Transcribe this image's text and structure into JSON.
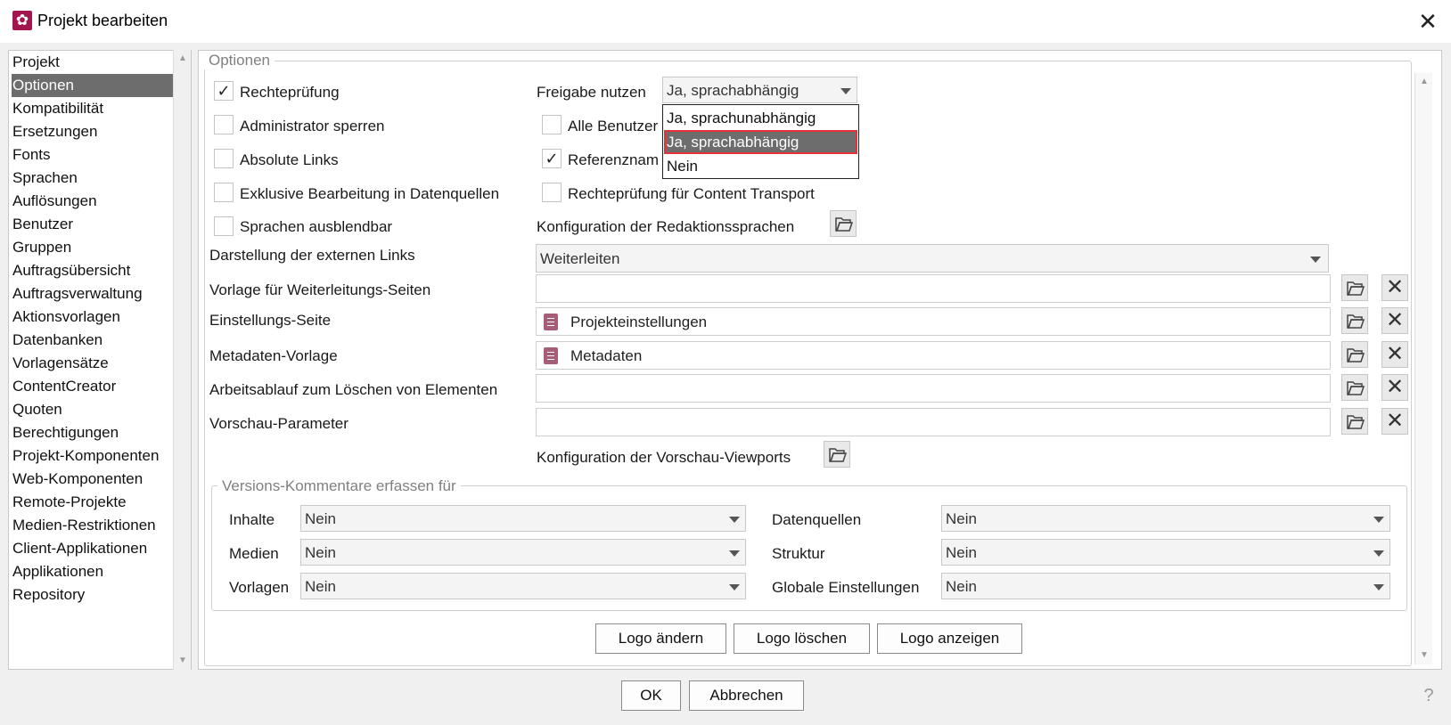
{
  "window": {
    "title": "Projekt bearbeiten"
  },
  "sidebar": {
    "items": [
      "Projekt",
      "Optionen",
      "Kompatibilität",
      "Ersetzungen",
      "Fonts",
      "Sprachen",
      "Auflösungen",
      "Benutzer",
      "Gruppen",
      "Auftragsübersicht",
      "Auftragsverwaltung",
      "Aktionsvorlagen",
      "Datenbanken",
      "Vorlagensätze",
      "ContentCreator",
      "Quoten",
      "Berechtigungen",
      "Projekt-Komponenten",
      "Web-Komponenten",
      "Remote-Projekte",
      "Medien-Restriktionen",
      "Client-Applikationen",
      "Applikationen",
      "Repository"
    ],
    "selected": "Optionen"
  },
  "options": {
    "legend": "Optionen",
    "left_checks": [
      {
        "label": "Rechteprüfung",
        "checked": true
      },
      {
        "label": "Administrator sperren",
        "checked": false
      },
      {
        "label": "Absolute Links",
        "checked": false
      },
      {
        "label": "Exklusive Bearbeitung in Datenquellen",
        "checked": false
      },
      {
        "label": "Sprachen ausblendbar",
        "checked": false
      }
    ],
    "freigabe_label": "Freigabe nutzen",
    "freigabe_value": "Ja, sprachabhängig",
    "freigabe_options": [
      "Ja, sprachunabhängig",
      "Ja, sprachabhängig",
      "Nein"
    ],
    "right_checks": [
      {
        "label": "Alle Benutzer",
        "checked": false
      },
      {
        "label": "Referenznam",
        "checked": true
      },
      {
        "label": "Rechteprüfung für Content Transport",
        "checked": false
      }
    ],
    "redaktionssprachen_label": "Konfiguration der Redaktionssprachen",
    "externe_links_label": "Darstellung der externen Links",
    "externe_links_value": "Weiterleiten",
    "rows": [
      {
        "label": "Vorlage für Weiterleitungs-Seiten",
        "value": ""
      },
      {
        "label": "Einstellungs-Seite",
        "value": "Projekteinstellungen"
      },
      {
        "label": "Metadaten-Vorlage",
        "value": "Metadaten"
      },
      {
        "label": "Arbeitsablauf zum Löschen von Elementen",
        "value": ""
      },
      {
        "label": "Vorschau-Parameter",
        "value": ""
      }
    ],
    "viewports_label": "Konfiguration der Vorschau-Viewports"
  },
  "versions": {
    "legend": "Versions-Kommentare erfassen für",
    "left": [
      {
        "label": "Inhalte",
        "value": "Nein"
      },
      {
        "label": "Medien",
        "value": "Nein"
      },
      {
        "label": "Vorlagen",
        "value": "Nein"
      }
    ],
    "right": [
      {
        "label": "Datenquellen",
        "value": "Nein"
      },
      {
        "label": "Struktur",
        "value": "Nein"
      },
      {
        "label": "Globale Einstellungen",
        "value": "Nein"
      }
    ]
  },
  "logo_buttons": {
    "change": "Logo ändern",
    "delete": "Logo löschen",
    "show": "Logo anzeigen"
  },
  "footer": {
    "ok": "OK",
    "cancel": "Abbrechen",
    "help": "?"
  },
  "icons": {
    "app": "gear-icon",
    "close": "close-icon",
    "open_folder": "folder-open-icon",
    "remove": "remove-icon",
    "document": "document-icon",
    "help": "help-icon",
    "check": "✓",
    "x": "✕"
  },
  "colors": {
    "app_icon": "#a3154f",
    "selection": "#6d6d6d",
    "highlight_border": "#e53238"
  }
}
